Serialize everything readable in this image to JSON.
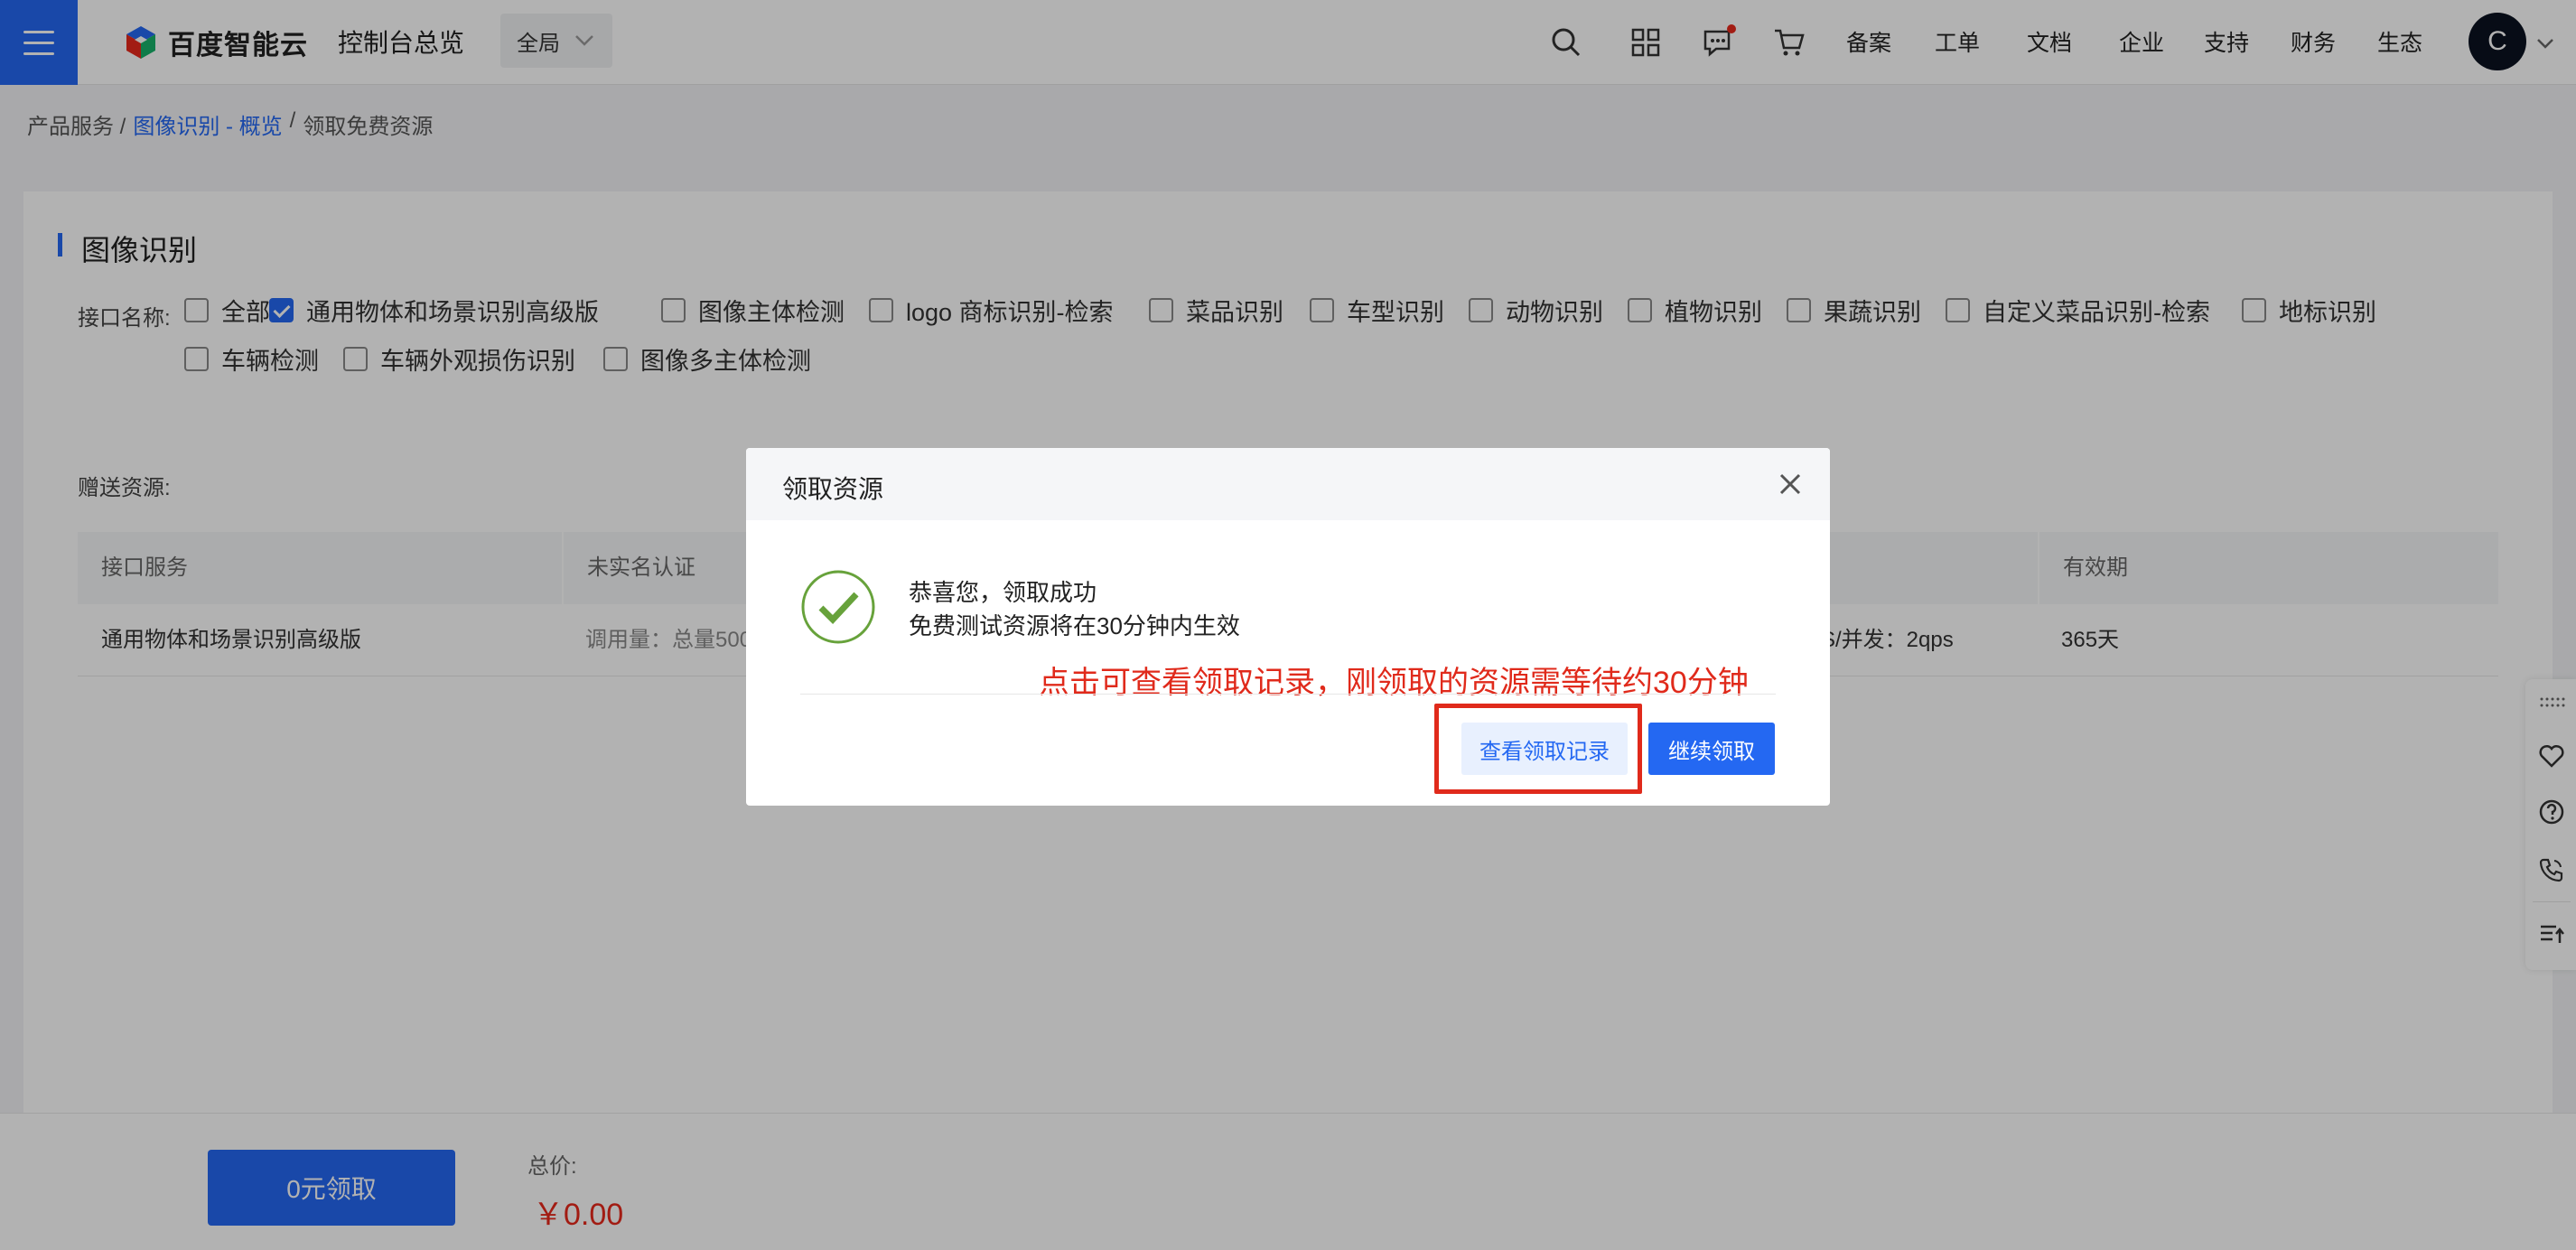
{
  "header": {
    "logo_text": "百度智能云",
    "console_title": "控制台总览",
    "scope": "全局",
    "nav": [
      "备案",
      "工单",
      "文档",
      "企业",
      "支持",
      "财务",
      "生态"
    ],
    "avatar_letter": "C",
    "accent": "#2468f2"
  },
  "breadcrumb": {
    "item1": "产品服务 /",
    "item2": "图像识别 - 概览",
    "item2_sep": "/",
    "item3": "领取免费资源"
  },
  "card": {
    "title": "图像识别",
    "api_label": "接口名称:",
    "options": [
      {
        "label": "全部",
        "checked": false
      },
      {
        "label": "通用物体和场景识别高级版",
        "checked": true
      },
      {
        "label": "图像主体检测",
        "checked": false
      },
      {
        "label": "logo 商标识别-检索",
        "checked": false
      },
      {
        "label": "菜品识别",
        "checked": false
      },
      {
        "label": "车型识别",
        "checked": false
      },
      {
        "label": "动物识别",
        "checked": false
      },
      {
        "label": "植物识别",
        "checked": false
      },
      {
        "label": "果蔬识别",
        "checked": false
      },
      {
        "label": "自定义菜品识别-检索",
        "checked": false
      },
      {
        "label": "地标识别",
        "checked": false
      },
      {
        "label": "车辆检测",
        "checked": false
      },
      {
        "label": "车辆外观损伤识别",
        "checked": false
      },
      {
        "label": "图像多主体检测",
        "checked": false
      }
    ],
    "gift_label": "赠送资源:",
    "table": {
      "headers": [
        "接口服务",
        "未实名认证",
        "有效期"
      ],
      "row": {
        "service": "通用物体和场景识别高级版",
        "usage": "调用量：总量500",
        "qps": "S/并发：2qps",
        "validity": "365天"
      }
    }
  },
  "footer": {
    "claim_button": "0元领取",
    "total_label": "总价:",
    "total_price": "￥0.00"
  },
  "modal": {
    "title": "领取资源",
    "success_title": "恭喜您，领取成功",
    "success_sub": "免费测试资源将在30分钟内生效",
    "annotation": "点击可查看领取记录，刚领取的资源需等待约30分钟",
    "btn_records": "查看领取记录",
    "btn_continue": "继续领取",
    "success_color": "#67a23b",
    "annotation_color": "#e02a1b"
  }
}
